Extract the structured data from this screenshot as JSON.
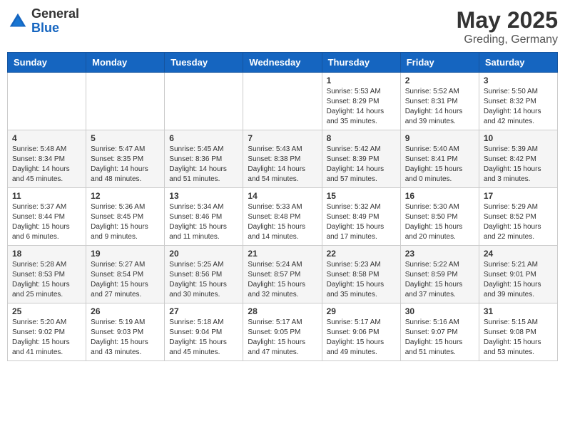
{
  "logo": {
    "general": "General",
    "blue": "Blue"
  },
  "title": {
    "month": "May 2025",
    "location": "Greding, Germany"
  },
  "weekdays": [
    "Sunday",
    "Monday",
    "Tuesday",
    "Wednesday",
    "Thursday",
    "Friday",
    "Saturday"
  ],
  "weeks": [
    [
      {
        "day": "",
        "info": ""
      },
      {
        "day": "",
        "info": ""
      },
      {
        "day": "",
        "info": ""
      },
      {
        "day": "",
        "info": ""
      },
      {
        "day": "1",
        "info": "Sunrise: 5:53 AM\nSunset: 8:29 PM\nDaylight: 14 hours\nand 35 minutes."
      },
      {
        "day": "2",
        "info": "Sunrise: 5:52 AM\nSunset: 8:31 PM\nDaylight: 14 hours\nand 39 minutes."
      },
      {
        "day": "3",
        "info": "Sunrise: 5:50 AM\nSunset: 8:32 PM\nDaylight: 14 hours\nand 42 minutes."
      }
    ],
    [
      {
        "day": "4",
        "info": "Sunrise: 5:48 AM\nSunset: 8:34 PM\nDaylight: 14 hours\nand 45 minutes."
      },
      {
        "day": "5",
        "info": "Sunrise: 5:47 AM\nSunset: 8:35 PM\nDaylight: 14 hours\nand 48 minutes."
      },
      {
        "day": "6",
        "info": "Sunrise: 5:45 AM\nSunset: 8:36 PM\nDaylight: 14 hours\nand 51 minutes."
      },
      {
        "day": "7",
        "info": "Sunrise: 5:43 AM\nSunset: 8:38 PM\nDaylight: 14 hours\nand 54 minutes."
      },
      {
        "day": "8",
        "info": "Sunrise: 5:42 AM\nSunset: 8:39 PM\nDaylight: 14 hours\nand 57 minutes."
      },
      {
        "day": "9",
        "info": "Sunrise: 5:40 AM\nSunset: 8:41 PM\nDaylight: 15 hours\nand 0 minutes."
      },
      {
        "day": "10",
        "info": "Sunrise: 5:39 AM\nSunset: 8:42 PM\nDaylight: 15 hours\nand 3 minutes."
      }
    ],
    [
      {
        "day": "11",
        "info": "Sunrise: 5:37 AM\nSunset: 8:44 PM\nDaylight: 15 hours\nand 6 minutes."
      },
      {
        "day": "12",
        "info": "Sunrise: 5:36 AM\nSunset: 8:45 PM\nDaylight: 15 hours\nand 9 minutes."
      },
      {
        "day": "13",
        "info": "Sunrise: 5:34 AM\nSunset: 8:46 PM\nDaylight: 15 hours\nand 11 minutes."
      },
      {
        "day": "14",
        "info": "Sunrise: 5:33 AM\nSunset: 8:48 PM\nDaylight: 15 hours\nand 14 minutes."
      },
      {
        "day": "15",
        "info": "Sunrise: 5:32 AM\nSunset: 8:49 PM\nDaylight: 15 hours\nand 17 minutes."
      },
      {
        "day": "16",
        "info": "Sunrise: 5:30 AM\nSunset: 8:50 PM\nDaylight: 15 hours\nand 20 minutes."
      },
      {
        "day": "17",
        "info": "Sunrise: 5:29 AM\nSunset: 8:52 PM\nDaylight: 15 hours\nand 22 minutes."
      }
    ],
    [
      {
        "day": "18",
        "info": "Sunrise: 5:28 AM\nSunset: 8:53 PM\nDaylight: 15 hours\nand 25 minutes."
      },
      {
        "day": "19",
        "info": "Sunrise: 5:27 AM\nSunset: 8:54 PM\nDaylight: 15 hours\nand 27 minutes."
      },
      {
        "day": "20",
        "info": "Sunrise: 5:25 AM\nSunset: 8:56 PM\nDaylight: 15 hours\nand 30 minutes."
      },
      {
        "day": "21",
        "info": "Sunrise: 5:24 AM\nSunset: 8:57 PM\nDaylight: 15 hours\nand 32 minutes."
      },
      {
        "day": "22",
        "info": "Sunrise: 5:23 AM\nSunset: 8:58 PM\nDaylight: 15 hours\nand 35 minutes."
      },
      {
        "day": "23",
        "info": "Sunrise: 5:22 AM\nSunset: 8:59 PM\nDaylight: 15 hours\nand 37 minutes."
      },
      {
        "day": "24",
        "info": "Sunrise: 5:21 AM\nSunset: 9:01 PM\nDaylight: 15 hours\nand 39 minutes."
      }
    ],
    [
      {
        "day": "25",
        "info": "Sunrise: 5:20 AM\nSunset: 9:02 PM\nDaylight: 15 hours\nand 41 minutes."
      },
      {
        "day": "26",
        "info": "Sunrise: 5:19 AM\nSunset: 9:03 PM\nDaylight: 15 hours\nand 43 minutes."
      },
      {
        "day": "27",
        "info": "Sunrise: 5:18 AM\nSunset: 9:04 PM\nDaylight: 15 hours\nand 45 minutes."
      },
      {
        "day": "28",
        "info": "Sunrise: 5:17 AM\nSunset: 9:05 PM\nDaylight: 15 hours\nand 47 minutes."
      },
      {
        "day": "29",
        "info": "Sunrise: 5:17 AM\nSunset: 9:06 PM\nDaylight: 15 hours\nand 49 minutes."
      },
      {
        "day": "30",
        "info": "Sunrise: 5:16 AM\nSunset: 9:07 PM\nDaylight: 15 hours\nand 51 minutes."
      },
      {
        "day": "31",
        "info": "Sunrise: 5:15 AM\nSunset: 9:08 PM\nDaylight: 15 hours\nand 53 minutes."
      }
    ]
  ]
}
